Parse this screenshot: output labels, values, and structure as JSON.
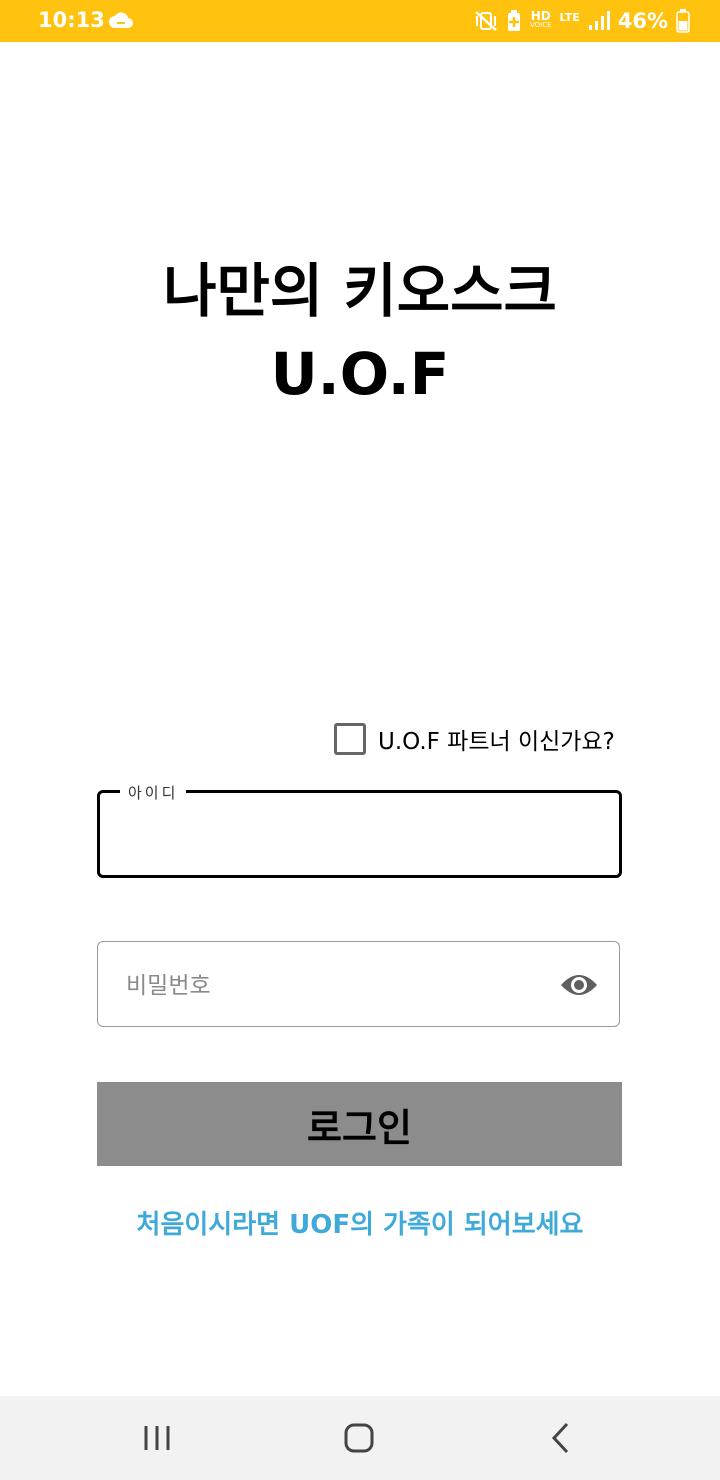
{
  "status_bar": {
    "time": "10:13",
    "hd": "HD",
    "voice": "VOICE",
    "lte": "LTE",
    "battery": "46%",
    "background_color": "#FFC20E",
    "icons": [
      "cloud-icon",
      "vibrate-mute-icon",
      "battery-saver-icon",
      "signal-icon",
      "battery-icon"
    ]
  },
  "title": {
    "line1": "나만의 키오스크",
    "line2": "U.O.F"
  },
  "partner_checkbox": {
    "label": "U.O.F 파트너 이신가요?",
    "checked": false
  },
  "id_field": {
    "label": "아이디",
    "value": ""
  },
  "password_field": {
    "placeholder": "비밀번호",
    "value": "",
    "toggle_icon": "eye-icon"
  },
  "login_button": {
    "label": "로그인",
    "color": "#8C8C8C"
  },
  "signup_link": {
    "text": "처음이시라면 UOF의 가족이 되어보세요",
    "color": "#3FA9D9"
  },
  "nav_bar": {
    "buttons": [
      "recents-icon",
      "home-icon",
      "back-icon"
    ]
  }
}
